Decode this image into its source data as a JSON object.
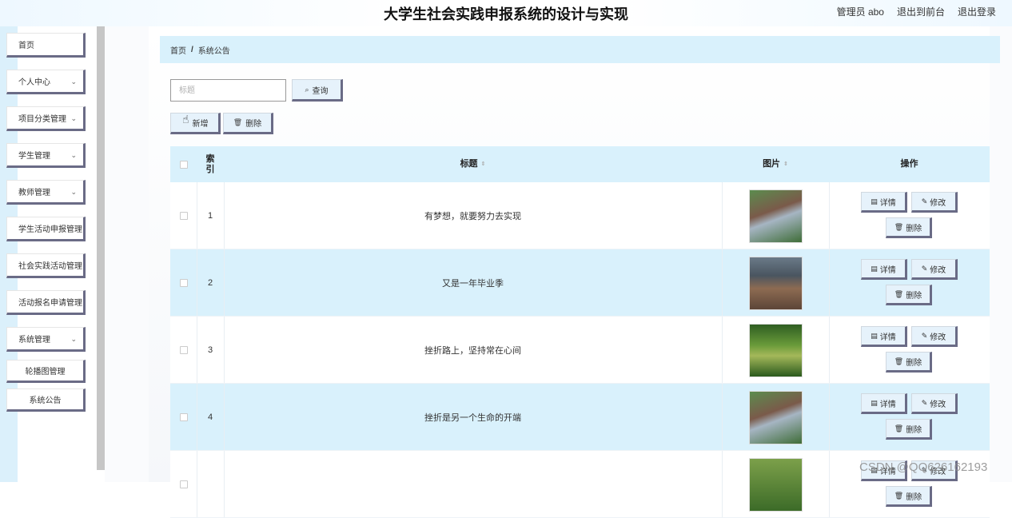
{
  "header": {
    "title": "大学生社会实践申报系统的设计与实现",
    "user": "管理员 abo",
    "back_to_front": "退出到前台",
    "logout": "退出登录"
  },
  "sidebar": {
    "items": [
      {
        "label": "首页",
        "has_arrow": false
      },
      {
        "label": "个人中心",
        "has_arrow": true
      },
      {
        "label": "项目分类管理",
        "has_arrow": true
      },
      {
        "label": "学生管理",
        "has_arrow": true
      },
      {
        "label": "教师管理",
        "has_arrow": true
      },
      {
        "label": "学生活动申报管理",
        "has_arrow": false
      },
      {
        "label": "社会实践活动管理",
        "has_arrow": false
      },
      {
        "label": "活动报名申请管理",
        "has_arrow": false
      },
      {
        "label": "系统管理",
        "has_arrow": true
      }
    ],
    "sub_items": [
      {
        "label": "轮播图管理"
      },
      {
        "label": "系统公告"
      }
    ],
    "arrow_glyph": "⌄"
  },
  "breadcrumb": {
    "home": "首页",
    "separator": "/",
    "current": "系统公告"
  },
  "search": {
    "placeholder": "标题",
    "value": "",
    "button_label": "查询",
    "button_icon": "🔍"
  },
  "toolbar": {
    "add_label": "新增",
    "delete_label": "删除",
    "delete_icon": "🗑"
  },
  "table": {
    "columns": {
      "index_line1": "索",
      "index_line2": "引",
      "title": "标题",
      "image": "图片",
      "actions": "操作"
    },
    "sort_glyph": "⇕",
    "rows": [
      {
        "index": "1",
        "title": "有梦想，就要努力去实现",
        "image": "campus-aerial"
      },
      {
        "index": "2",
        "title": "又是一年毕业季",
        "image": "classroom"
      },
      {
        "index": "3",
        "title": "挫折路上，坚持常在心间",
        "image": "forest-path"
      },
      {
        "index": "4",
        "title": "挫折是另一个生命的开端",
        "image": "campus-aerial"
      },
      {
        "index": "",
        "title": "",
        "image": "forest"
      }
    ],
    "row_actions": {
      "detail": "详情",
      "edit": "修改",
      "delete": "删除",
      "detail_icon": "▤",
      "edit_icon": "✎",
      "delete_icon": "🗑"
    }
  },
  "watermark": "CSDN @QQ626162193",
  "colors": {
    "accent_light": "#d9f1fc",
    "button_shadow": "#6a6b86",
    "scrollbar": "#c6c6c6"
  }
}
